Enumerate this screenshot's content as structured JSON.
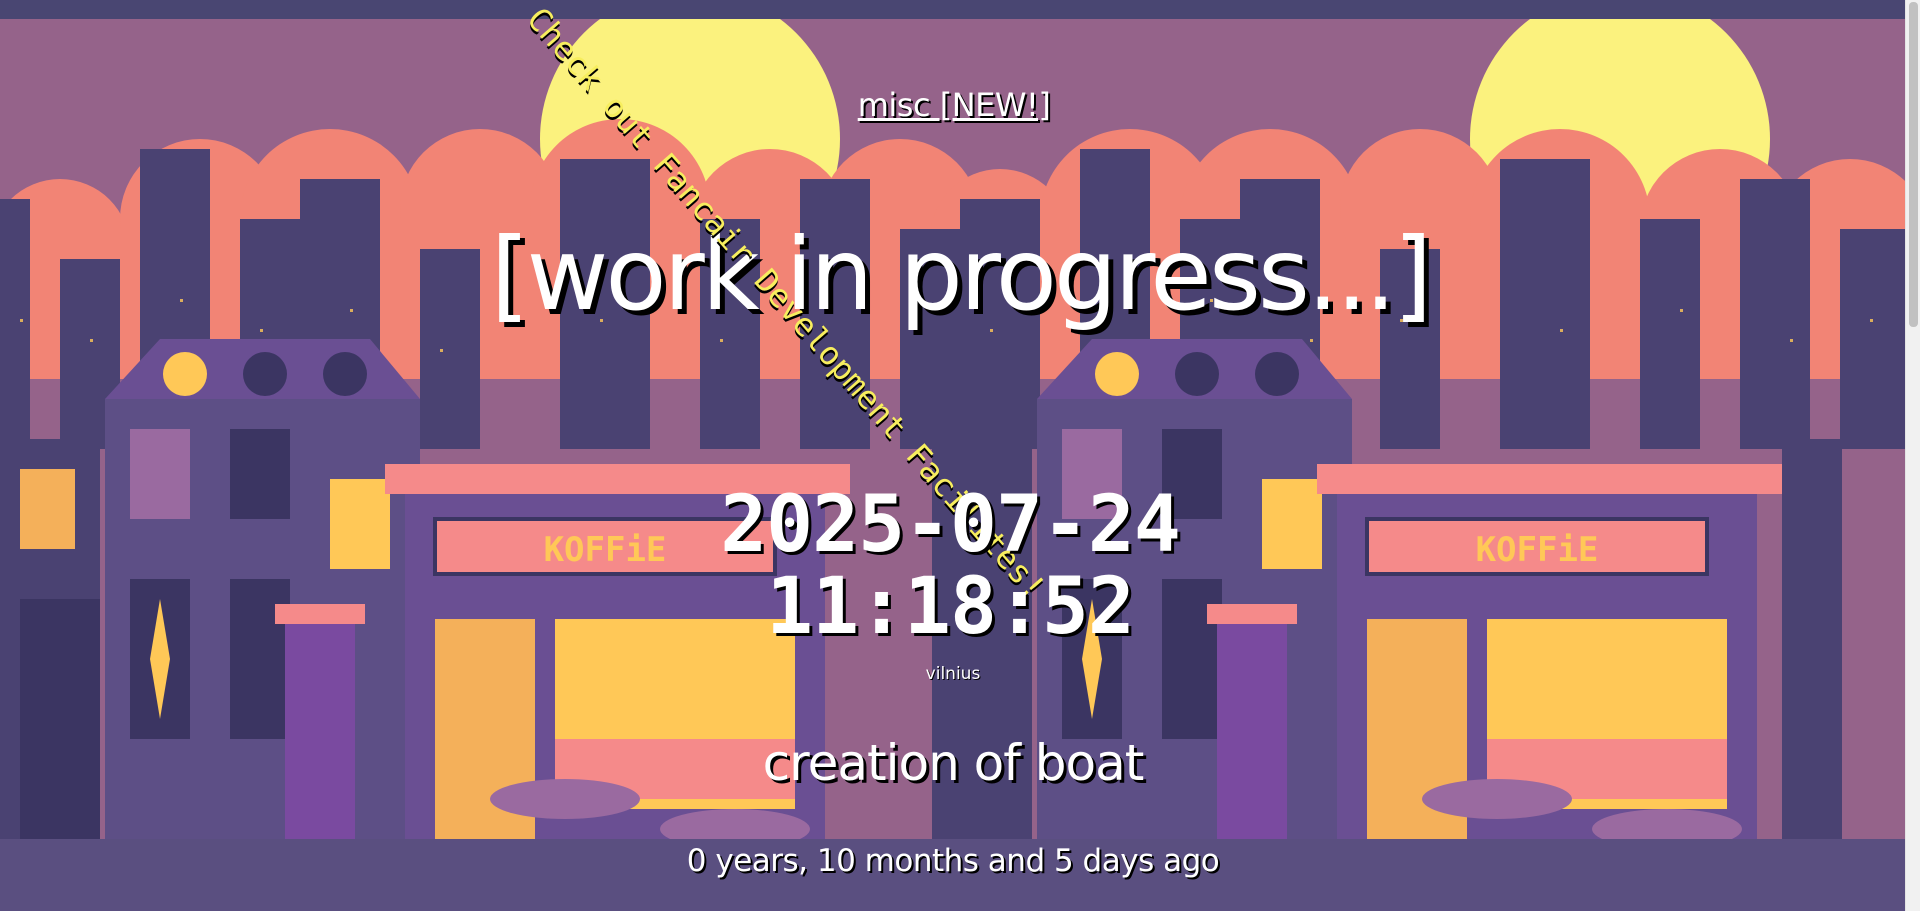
{
  "nav": {
    "link_label": "misc [NEW!]"
  },
  "marquee": {
    "text": "Check out Fancair Development Facilites!"
  },
  "hero": {
    "title": "[work in progress...]"
  },
  "clock": {
    "date": "2025-07-24",
    "time": "11:18:52",
    "location": "vilnius"
  },
  "creation": {
    "title": "creation of boat",
    "elapsed": "0 years, 10 months and 5 days ago"
  },
  "scene": {
    "shop_sign": "KOFFiE"
  },
  "colors": {
    "sky": "#95638a",
    "sun": "#fbf27e",
    "clouds": "#f28475",
    "city": "#4a4272",
    "building": "#5d4f86",
    "window_light": "#ffc857",
    "shop_pink": "#f58a8a",
    "marquee_yellow": "#f7ee5e",
    "text": "#ffffff"
  }
}
